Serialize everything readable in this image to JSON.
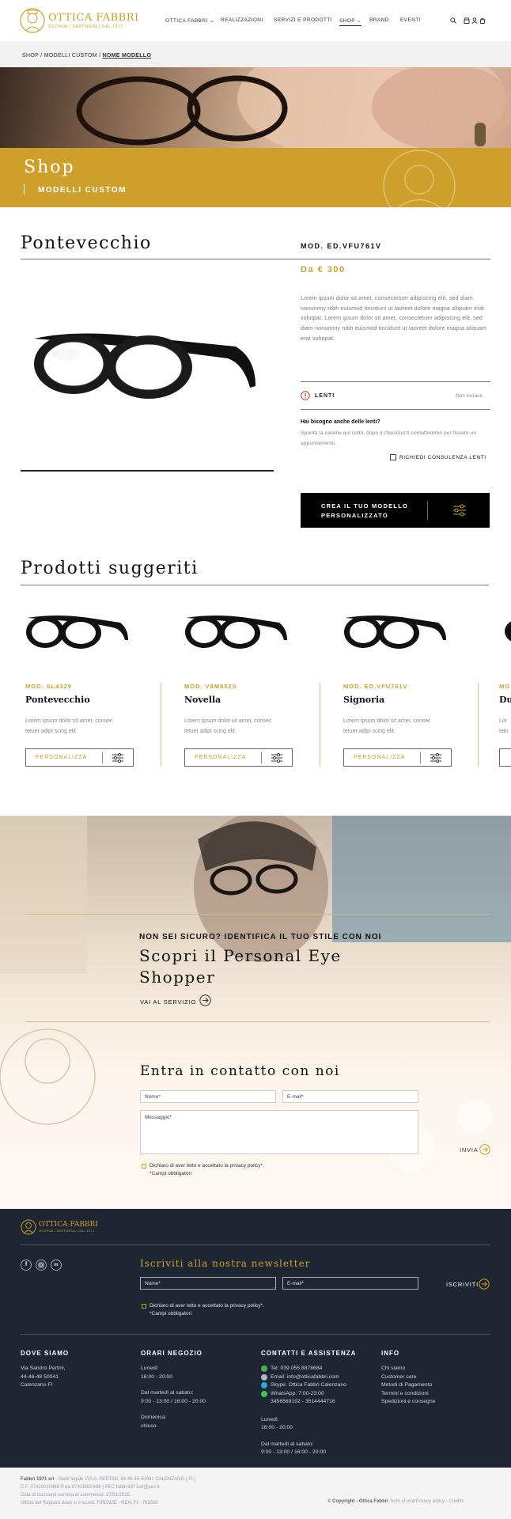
{
  "brand": {
    "name": "OTTICA FABBRI",
    "tagline": "OCCHIALI SARTORIALI DAL 1971"
  },
  "nav": [
    {
      "label": "OTTICA FABBRI",
      "dropdown": true
    },
    {
      "label": "REALIZZAZIONI"
    },
    {
      "label": "SERVIZI E PRODOTTI"
    },
    {
      "label": "SHOP",
      "dropdown": true,
      "active": true
    },
    {
      "label": "BRAND"
    },
    {
      "label": "EVENTI"
    }
  ],
  "breadcrumb": {
    "b1": "SHOP",
    "sep": "/",
    "b2": "MODELLI CUSTOM",
    "b3": "NOME MODELLO"
  },
  "banner": {
    "title": "Shop",
    "subtitle": "MODELLI CUSTOM"
  },
  "product": {
    "name": "Pontevecchio",
    "model": "MOD. ED.VFU761V",
    "price": "Da € 300",
    "description": "Lorem ipsum dolor sit amet, consectetuer adipiscing elit, sed diam nonummy nibh euismod tincidunt ut laoreet dolore magna aliquam erat volutpat. Lorem ipsum dolor sit amet, consectetuer adipiscing elit, sed diam nonummy nibh euismod tincidunt ut laoreet dolore magna aliquam erat volutpat.",
    "lenti_label": "LENTI",
    "lenti_value": "Non incluse",
    "help_title": "Hai bisogno anche delle lenti?",
    "help_text": "Spunta la casella qui sotto, dopo il checkout ti contatteremo per fissare un appuntamento.",
    "consult_label": "RICHIEDI CONSULENZA LENTI",
    "cta_label_1": "CREA IL TUO MODELLO",
    "cta_label_2": "PERSONALIZZATO"
  },
  "suggested": {
    "title": "Prodotti suggeriti",
    "cards": [
      {
        "mod": "MOD. SL4329",
        "name": "Pontevecchio",
        "text1": "Lorem ipsum dolor sit amet, consec",
        "text2": "tetuer adipi scing elit.",
        "button": "PERSONALIZZA"
      },
      {
        "mod": "MOD. V8M852S",
        "name": "Novella",
        "text1": "Lorem ipsum dolor sit amet, consec",
        "text2": "tetuer adipi scing elit.",
        "button": "PERSONALIZZA"
      },
      {
        "mod": "MOD. ED.VFU761V",
        "name": "Signoria",
        "text1": "Lorem ipsum dolor sit amet, consec",
        "text2": "tetuer adipi scing elit.",
        "button": "PERSONALIZZA"
      },
      {
        "mod": "MO",
        "name": "Du",
        "text1": "Lor",
        "text2": "tetu",
        "button": ""
      }
    ]
  },
  "eyeshopper": {
    "kicker": "NON SEI SICURO? IDENTIFICA IL TUO STILE CON NOI",
    "title1": "Scopri il Personal Eye",
    "title2": "Shopper",
    "link": "VAI AL SERVIZIO"
  },
  "contact": {
    "title": "Entra in contatto con noi",
    "name_placeholder": "Nome*",
    "email_placeholder": "E-mail*",
    "message_placeholder": "Messaggio*",
    "privacy": "Dichiaro di aver letto e accettato la privacy policy*.",
    "required": "*Campi obbligatori",
    "send": "INVIA"
  },
  "footer": {
    "newsletter_title": "Iscriviti alla nostra newsletter",
    "name_placeholder": "Nome*",
    "email_placeholder": "E-mail*",
    "subscribe": "ISCRIVITI",
    "privacy": "Dichiaro di aver letto e accettato la privacy policy*.",
    "required": "*Campi obbligatori",
    "where_title": "DOVE SIAMO",
    "where": [
      "Via Sandro Pertini,",
      "44-46-48 50041",
      "Calenzano FI"
    ],
    "hours_title": "ORARI NEGOZIO",
    "hours": [
      "Lunedì:",
      "16:00 - 20:00",
      "",
      "Dal martedì al sabato:",
      "9:00 - 13:00 / 16:00 - 20:00",
      "",
      "Domenica:",
      "chiuso"
    ],
    "contacts_title": "CONTATTI E ASSISTENZA",
    "contacts": [
      "Tel: 039 055 8878684",
      "Email: info@otticafabbri.com",
      "Skype: Ottica Fabbri Calenzano",
      "WhatsApp: 7:00-23:00",
      "3456589192 - 3514444716"
    ],
    "contacts_hours": [
      "Lunedì:",
      "16:00 - 20:00",
      "",
      "Dal martedì al sabato:",
      "9:00 - 13:00 / 16:00 - 20:00"
    ],
    "info_title": "INFO",
    "info": [
      "Chi siamo",
      "Customer care",
      "Metodi di Pagamento",
      "Termini e condizioni",
      "Spedizioni e consegne"
    ]
  },
  "legal": {
    "company": "Fabbri 1971 srl",
    "line1": " - Sede legale VIA S. PERTINI, 44-46-48 50041 CALENZANO ( FI )",
    "line2": "C.F. 07429010486 P.iva 07429010486 | PEC fabbri1971srl@pec.it",
    "line3": "Data di iscrizione camera di commercio: 27/01/2025",
    "line4": "Ufficio del Registro dove si è iscritti: FIRENZE - REA: FI - 702539",
    "copyright": "© Copyright - Ottica Fabbri",
    "links": "Term of use/Privacy policy - Credits"
  },
  "colors": {
    "gold": "#cf9f2c",
    "navy": "#1f2633",
    "accent_text": "#c9a227"
  }
}
